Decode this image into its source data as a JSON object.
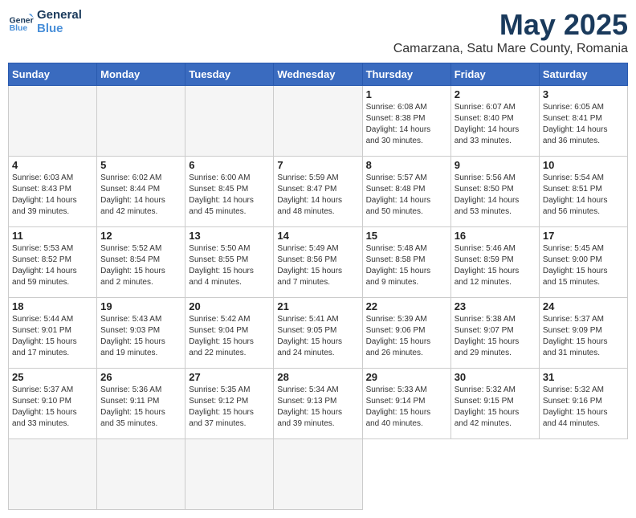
{
  "header": {
    "logo_line1": "General",
    "logo_line2": "Blue",
    "month": "May 2025",
    "location": "Camarzana, Satu Mare County, Romania"
  },
  "weekdays": [
    "Sunday",
    "Monday",
    "Tuesday",
    "Wednesday",
    "Thursday",
    "Friday",
    "Saturday"
  ],
  "days": [
    {
      "day": "",
      "info": ""
    },
    {
      "day": "",
      "info": ""
    },
    {
      "day": "",
      "info": ""
    },
    {
      "day": "",
      "info": ""
    },
    {
      "day": "1",
      "info": "Sunrise: 6:08 AM\nSunset: 8:38 PM\nDaylight: 14 hours\nand 30 minutes."
    },
    {
      "day": "2",
      "info": "Sunrise: 6:07 AM\nSunset: 8:40 PM\nDaylight: 14 hours\nand 33 minutes."
    },
    {
      "day": "3",
      "info": "Sunrise: 6:05 AM\nSunset: 8:41 PM\nDaylight: 14 hours\nand 36 minutes."
    },
    {
      "day": "4",
      "info": "Sunrise: 6:03 AM\nSunset: 8:43 PM\nDaylight: 14 hours\nand 39 minutes."
    },
    {
      "day": "5",
      "info": "Sunrise: 6:02 AM\nSunset: 8:44 PM\nDaylight: 14 hours\nand 42 minutes."
    },
    {
      "day": "6",
      "info": "Sunrise: 6:00 AM\nSunset: 8:45 PM\nDaylight: 14 hours\nand 45 minutes."
    },
    {
      "day": "7",
      "info": "Sunrise: 5:59 AM\nSunset: 8:47 PM\nDaylight: 14 hours\nand 48 minutes."
    },
    {
      "day": "8",
      "info": "Sunrise: 5:57 AM\nSunset: 8:48 PM\nDaylight: 14 hours\nand 50 minutes."
    },
    {
      "day": "9",
      "info": "Sunrise: 5:56 AM\nSunset: 8:50 PM\nDaylight: 14 hours\nand 53 minutes."
    },
    {
      "day": "10",
      "info": "Sunrise: 5:54 AM\nSunset: 8:51 PM\nDaylight: 14 hours\nand 56 minutes."
    },
    {
      "day": "11",
      "info": "Sunrise: 5:53 AM\nSunset: 8:52 PM\nDaylight: 14 hours\nand 59 minutes."
    },
    {
      "day": "12",
      "info": "Sunrise: 5:52 AM\nSunset: 8:54 PM\nDaylight: 15 hours\nand 2 minutes."
    },
    {
      "day": "13",
      "info": "Sunrise: 5:50 AM\nSunset: 8:55 PM\nDaylight: 15 hours\nand 4 minutes."
    },
    {
      "day": "14",
      "info": "Sunrise: 5:49 AM\nSunset: 8:56 PM\nDaylight: 15 hours\nand 7 minutes."
    },
    {
      "day": "15",
      "info": "Sunrise: 5:48 AM\nSunset: 8:58 PM\nDaylight: 15 hours\nand 9 minutes."
    },
    {
      "day": "16",
      "info": "Sunrise: 5:46 AM\nSunset: 8:59 PM\nDaylight: 15 hours\nand 12 minutes."
    },
    {
      "day": "17",
      "info": "Sunrise: 5:45 AM\nSunset: 9:00 PM\nDaylight: 15 hours\nand 15 minutes."
    },
    {
      "day": "18",
      "info": "Sunrise: 5:44 AM\nSunset: 9:01 PM\nDaylight: 15 hours\nand 17 minutes."
    },
    {
      "day": "19",
      "info": "Sunrise: 5:43 AM\nSunset: 9:03 PM\nDaylight: 15 hours\nand 19 minutes."
    },
    {
      "day": "20",
      "info": "Sunrise: 5:42 AM\nSunset: 9:04 PM\nDaylight: 15 hours\nand 22 minutes."
    },
    {
      "day": "21",
      "info": "Sunrise: 5:41 AM\nSunset: 9:05 PM\nDaylight: 15 hours\nand 24 minutes."
    },
    {
      "day": "22",
      "info": "Sunrise: 5:39 AM\nSunset: 9:06 PM\nDaylight: 15 hours\nand 26 minutes."
    },
    {
      "day": "23",
      "info": "Sunrise: 5:38 AM\nSunset: 9:07 PM\nDaylight: 15 hours\nand 29 minutes."
    },
    {
      "day": "24",
      "info": "Sunrise: 5:37 AM\nSunset: 9:09 PM\nDaylight: 15 hours\nand 31 minutes."
    },
    {
      "day": "25",
      "info": "Sunrise: 5:37 AM\nSunset: 9:10 PM\nDaylight: 15 hours\nand 33 minutes."
    },
    {
      "day": "26",
      "info": "Sunrise: 5:36 AM\nSunset: 9:11 PM\nDaylight: 15 hours\nand 35 minutes."
    },
    {
      "day": "27",
      "info": "Sunrise: 5:35 AM\nSunset: 9:12 PM\nDaylight: 15 hours\nand 37 minutes."
    },
    {
      "day": "28",
      "info": "Sunrise: 5:34 AM\nSunset: 9:13 PM\nDaylight: 15 hours\nand 39 minutes."
    },
    {
      "day": "29",
      "info": "Sunrise: 5:33 AM\nSunset: 9:14 PM\nDaylight: 15 hours\nand 40 minutes."
    },
    {
      "day": "30",
      "info": "Sunrise: 5:32 AM\nSunset: 9:15 PM\nDaylight: 15 hours\nand 42 minutes."
    },
    {
      "day": "31",
      "info": "Sunrise: 5:32 AM\nSunset: 9:16 PM\nDaylight: 15 hours\nand 44 minutes."
    },
    {
      "day": "",
      "info": ""
    },
    {
      "day": "",
      "info": ""
    },
    {
      "day": "",
      "info": ""
    },
    {
      "day": "",
      "info": ""
    }
  ]
}
